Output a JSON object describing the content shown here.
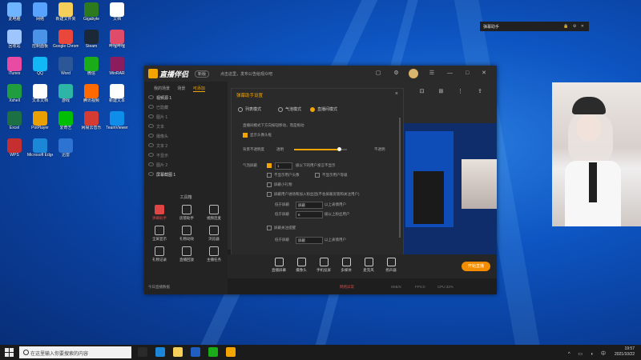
{
  "desktop": {
    "icons": [
      {
        "label": "此电脑",
        "color": "#6fb4ff"
      },
      {
        "label": "网络",
        "color": "#57a3ff"
      },
      {
        "label": "新建文件夹",
        "color": "#f6cf5a"
      },
      {
        "label": "Gigabyte",
        "color": "#2d7a1e"
      },
      {
        "label": "文档",
        "color": "#ffffff"
      },
      {
        "label": "回收站",
        "color": "#9fc5ff"
      },
      {
        "label": "控制面板",
        "color": "#4b93e6"
      },
      {
        "label": "Google Chrome",
        "color": "#e9473c"
      },
      {
        "label": "Steam",
        "color": "#1b2838"
      },
      {
        "label": "哔哩哔哩",
        "color": "#e14b6a"
      },
      {
        "label": "iTunes",
        "color": "#e84ba1"
      },
      {
        "label": "QQ",
        "color": "#12b7f5"
      },
      {
        "label": "Word",
        "color": "#2b5797"
      },
      {
        "label": "微信",
        "color": "#1aad19"
      },
      {
        "label": "WinRAR",
        "color": "#8b1d5f"
      },
      {
        "label": "Xshell",
        "color": "#1f9d3f"
      },
      {
        "label": "文本文档",
        "color": "#ffffff"
      },
      {
        "label": "游戏",
        "color": "#2db5a6"
      },
      {
        "label": "腾讯视频",
        "color": "#ff6a00"
      },
      {
        "label": "新建文本",
        "color": "#ffffff"
      },
      {
        "label": "Excel",
        "color": "#1d7044"
      },
      {
        "label": "PotPlayer",
        "color": "#e9a000"
      },
      {
        "label": "爱奇艺",
        "color": "#00be06"
      },
      {
        "label": "网易云音乐",
        "color": "#d43c33"
      },
      {
        "label": "TeamViewer",
        "color": "#0e8ee9"
      },
      {
        "label": "WPS",
        "color": "#c62f2f"
      },
      {
        "label": "Microsoft Edge",
        "color": "#1b87d6"
      },
      {
        "label": "迅雷",
        "color": "#2c73d2"
      }
    ]
  },
  "taskbar": {
    "search_placeholder": "在这里输入你要搜索的内容",
    "time": "19:57",
    "date": "2021/10/22",
    "apps": [
      {
        "name": "task-view",
        "color": "#2a2a2a"
      },
      {
        "name": "edge",
        "color": "#1b87d6"
      },
      {
        "name": "explorer",
        "color": "#f6cf5a"
      },
      {
        "name": "app-blue",
        "color": "#1f5fbf"
      },
      {
        "name": "wechat",
        "color": "#1aad19"
      },
      {
        "name": "live-assistant",
        "color": "#f2a400"
      }
    ]
  },
  "app": {
    "logo": "直播伴侣",
    "version": "新版",
    "notice": "点击这里，发布公告给观众吧",
    "left_tabs": [
      "我的场景",
      "场景",
      "可添加"
    ],
    "layers": [
      "视频源 1",
      "已隐藏",
      "图片 1",
      "文本",
      "摄像头",
      "文本 2",
      "不显示",
      "图片 2",
      "屏幕截图 1"
    ],
    "tools_title": "工具箱",
    "tools": [
      {
        "label": "弹幕助手",
        "red": true
      },
      {
        "label": "房管助手",
        "red": false
      },
      {
        "label": "视频连麦",
        "red": false
      },
      {
        "label": "全屏显示",
        "red": false
      },
      {
        "label": "礼物动效",
        "red": false
      },
      {
        "label": "浏览器",
        "red": false
      },
      {
        "label": "礼物记录",
        "red": false
      },
      {
        "label": "直播回放",
        "red": false
      },
      {
        "label": "主播任务",
        "red": false
      }
    ],
    "left_footer": "今日直播数据",
    "bottom_actions": [
      "直播屏幕",
      "摄像头",
      "手机投屏",
      "多媒体",
      "麦克风",
      "扬声器"
    ],
    "live_button": "开始直播",
    "status": {
      "warn": "网络异常",
      "net": "0KB/S",
      "fps": "FPS:0",
      "cpu": "CPU:32%"
    }
  },
  "dialog": {
    "title": "弹幕助手设置",
    "close": "×",
    "modes": [
      "列表模式",
      "气泡模式",
      "直播间模式"
    ],
    "selected_mode": 2,
    "desc": "直播间模式下方向按钮移动，而是拖动",
    "show_bg": "显示头像头框",
    "opacity_label": "背景不透明度",
    "opacity_min": "透明",
    "opacity_max": "不透明",
    "opacity_value": 0.85,
    "filter_label": "气泡屏蔽",
    "filter_count": "1",
    "filter_text": "级以下的用户发言不显示",
    "opt1": "不显示用户头像",
    "opt2": "不显示用户等级",
    "opt3": "屏蔽小礼物",
    "opt4": "屏蔽用户进场和加入粉丝团(不会屏蔽房管和关注用户)",
    "sub_filter_label": "低于屏蔽",
    "sub_filter_opt1": "屏蔽",
    "sub_filter_hint1": "以上表情用户",
    "sub_filter_opt2": "6",
    "sub_filter_hint2": "级以上粉丝用户",
    "opt5": "屏蔽关注提醒",
    "sub_filter_opt3": "屏蔽",
    "sub_filter_hint3": "以上表情用户"
  },
  "widget": {
    "title": "弹幕助手",
    "controls": "🔒 ⚙ ✕"
  }
}
